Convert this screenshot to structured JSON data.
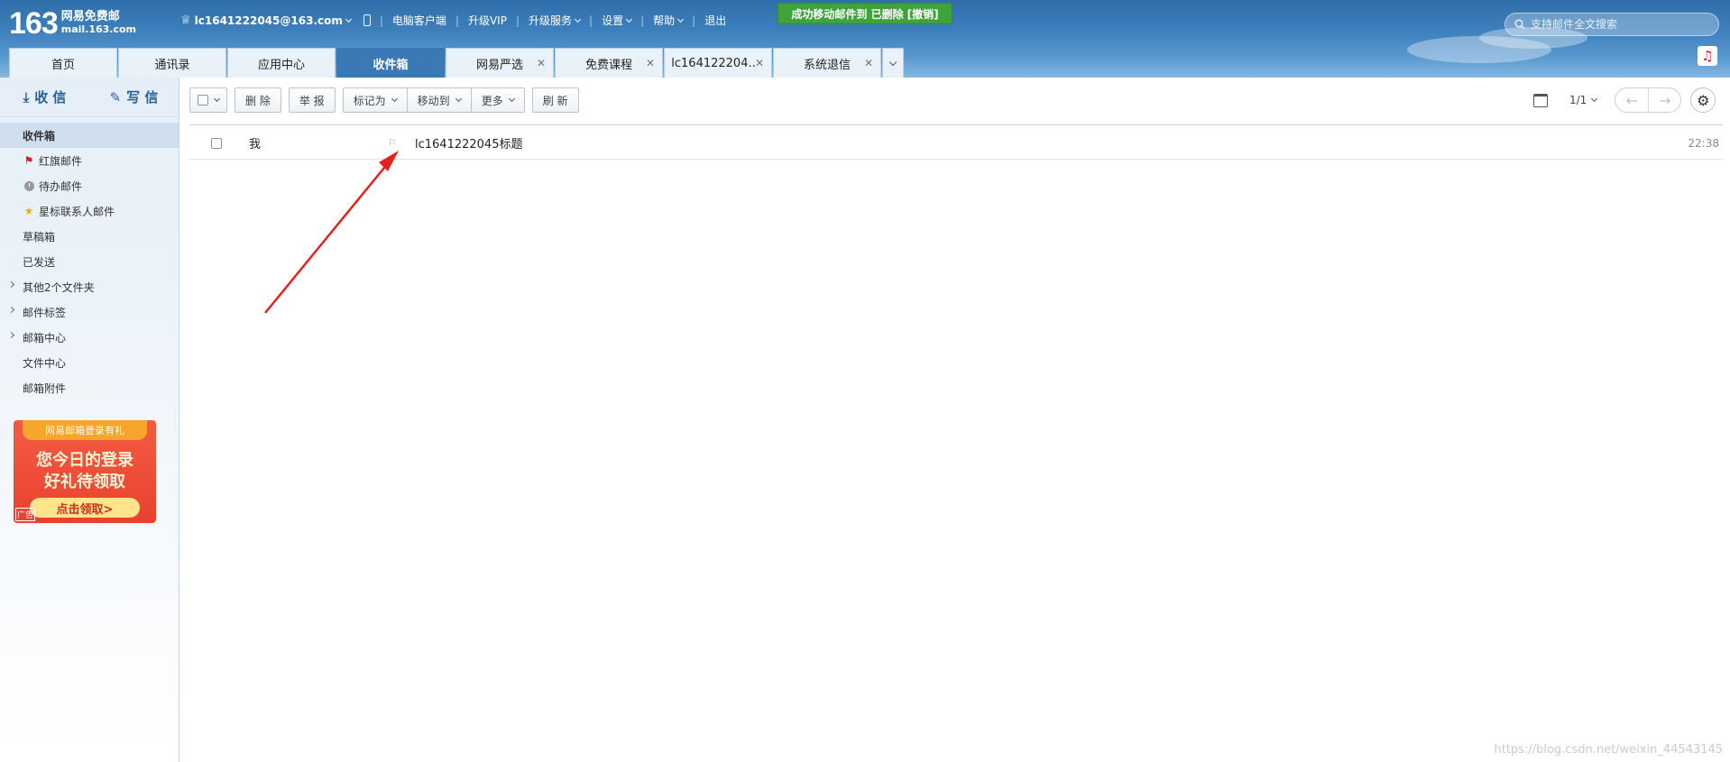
{
  "logo": {
    "number": "163",
    "name": "网易免费邮",
    "domain": "mail.163.com"
  },
  "user_nav": {
    "account": "lc1641222045@163.com",
    "links": [
      "电脑客户端",
      "升级VIP",
      "升级服务",
      "设置",
      "帮助",
      "退出"
    ]
  },
  "toast": {
    "message": "成功移动邮件到 已删除",
    "undo": "[撤销]"
  },
  "search": {
    "placeholder": "支持邮件全文搜索"
  },
  "tabs": [
    {
      "label": "首页"
    },
    {
      "label": "通讯录"
    },
    {
      "label": "应用中心"
    },
    {
      "label": "收件箱"
    },
    {
      "label": "网易严选"
    },
    {
      "label": "免费课程"
    },
    {
      "label": "lc164122204.."
    },
    {
      "label": "系统退信"
    }
  ],
  "sidebar": {
    "receive": "收 信",
    "compose": "写 信",
    "folders": [
      {
        "label": "收件箱"
      },
      {
        "label": "红旗邮件"
      },
      {
        "label": "待办邮件"
      },
      {
        "label": "星标联系人邮件"
      },
      {
        "label": "草稿箱"
      },
      {
        "label": "已发送"
      },
      {
        "label": "其他2个文件夹"
      },
      {
        "label": "邮件标签"
      },
      {
        "label": "邮箱中心"
      },
      {
        "label": "文件中心"
      },
      {
        "label": "邮箱附件"
      }
    ],
    "promo": {
      "ribbon": "网易邮箱登录有礼",
      "line1": "您今日的登录",
      "line2": "好礼待领取",
      "cta": "点击领取>",
      "ad": "广告"
    }
  },
  "toolbar": {
    "delete": "删 除",
    "report": "举 报",
    "mark_as": "标记为",
    "move_to": "移动到",
    "more": "更多",
    "refresh": "刷 新"
  },
  "pager": {
    "text": "1/1"
  },
  "mails": [
    {
      "from": "我",
      "subject": "lc1641222045标题",
      "time": "22:38"
    }
  ],
  "watermark": "https://blog.csdn.net/weixin_44543145",
  "colors": {
    "header": "#3d80bd",
    "active_tab": "#3b78b6",
    "toast": "#3fa33b",
    "arrow": "#e8201a"
  }
}
